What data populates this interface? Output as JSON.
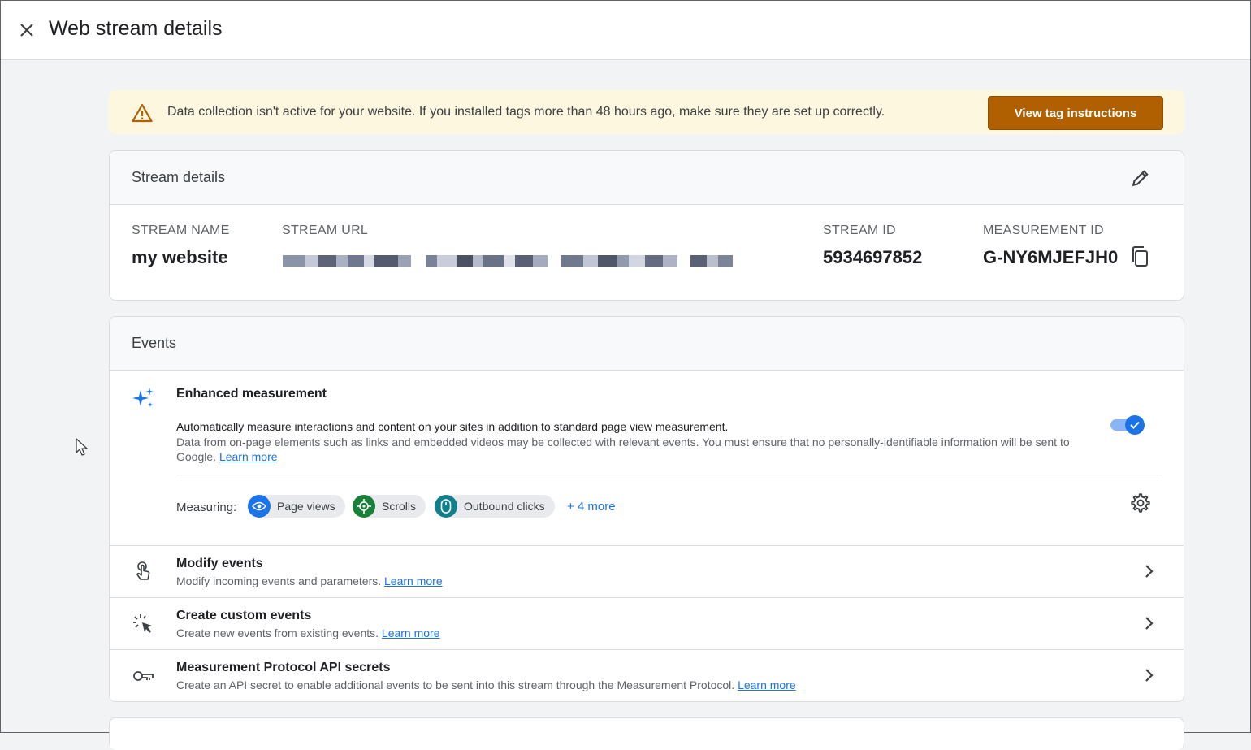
{
  "header": {
    "title": "Web stream details",
    "close_icon": "close-icon"
  },
  "alert": {
    "icon": "warning-icon",
    "message": "Data collection isn't active for your website. If you installed tags more than 48 hours ago, make sure they are set up correctly.",
    "button_label": "View tag instructions",
    "colors": {
      "background": "#fef7e0",
      "button": "#b06000"
    }
  },
  "stream_details": {
    "title": "Stream details",
    "edit_icon": "pencil-icon",
    "fields": {
      "stream_name": {
        "label": "STREAM NAME",
        "value": "my website"
      },
      "stream_url": {
        "label": "STREAM URL",
        "value_redacted": true
      },
      "stream_id": {
        "label": "STREAM ID",
        "value": "5934697852"
      },
      "measurement_id": {
        "label": "MEASUREMENT ID",
        "value": "G-NY6MJEFJH0",
        "copy_icon": "copy-icon"
      }
    }
  },
  "events": {
    "title": "Events",
    "enhanced_measurement": {
      "icon": "sparkle-icon",
      "title": "Enhanced measurement",
      "description": "Automatically measure interactions and content on your sites in addition to standard page view measurement.",
      "note": "Data from on-page elements such as links and embedded videos may be collected with relevant events. You must ensure that no personally-identifiable information will be sent to Google.",
      "learn_more": "Learn more",
      "toggle_on": true,
      "measuring_label": "Measuring:",
      "chips": [
        {
          "label": "Page views",
          "icon": "eye-icon",
          "color": "#1a73e8"
        },
        {
          "label": "Scrolls",
          "icon": "scroll-target-icon",
          "color": "#188038"
        },
        {
          "label": "Outbound clicks",
          "icon": "mouse-icon",
          "color": "#12808c"
        }
      ],
      "more_label": "+ 4 more",
      "settings_icon": "gear-icon"
    },
    "rows": [
      {
        "title": "Modify events",
        "subtitle": "Modify incoming events and parameters.",
        "link": "Learn more",
        "icon": "touch-hand-icon"
      },
      {
        "title": "Create custom events",
        "subtitle": "Create new events from existing events.",
        "link": "Learn more",
        "icon": "click-sparkle-icon"
      },
      {
        "title": "Measurement Protocol API secrets",
        "subtitle": "Create an API secret to enable additional events to be sent into this stream through the Measurement Protocol.",
        "link": "Learn more",
        "icon": "key-icon"
      }
    ]
  }
}
